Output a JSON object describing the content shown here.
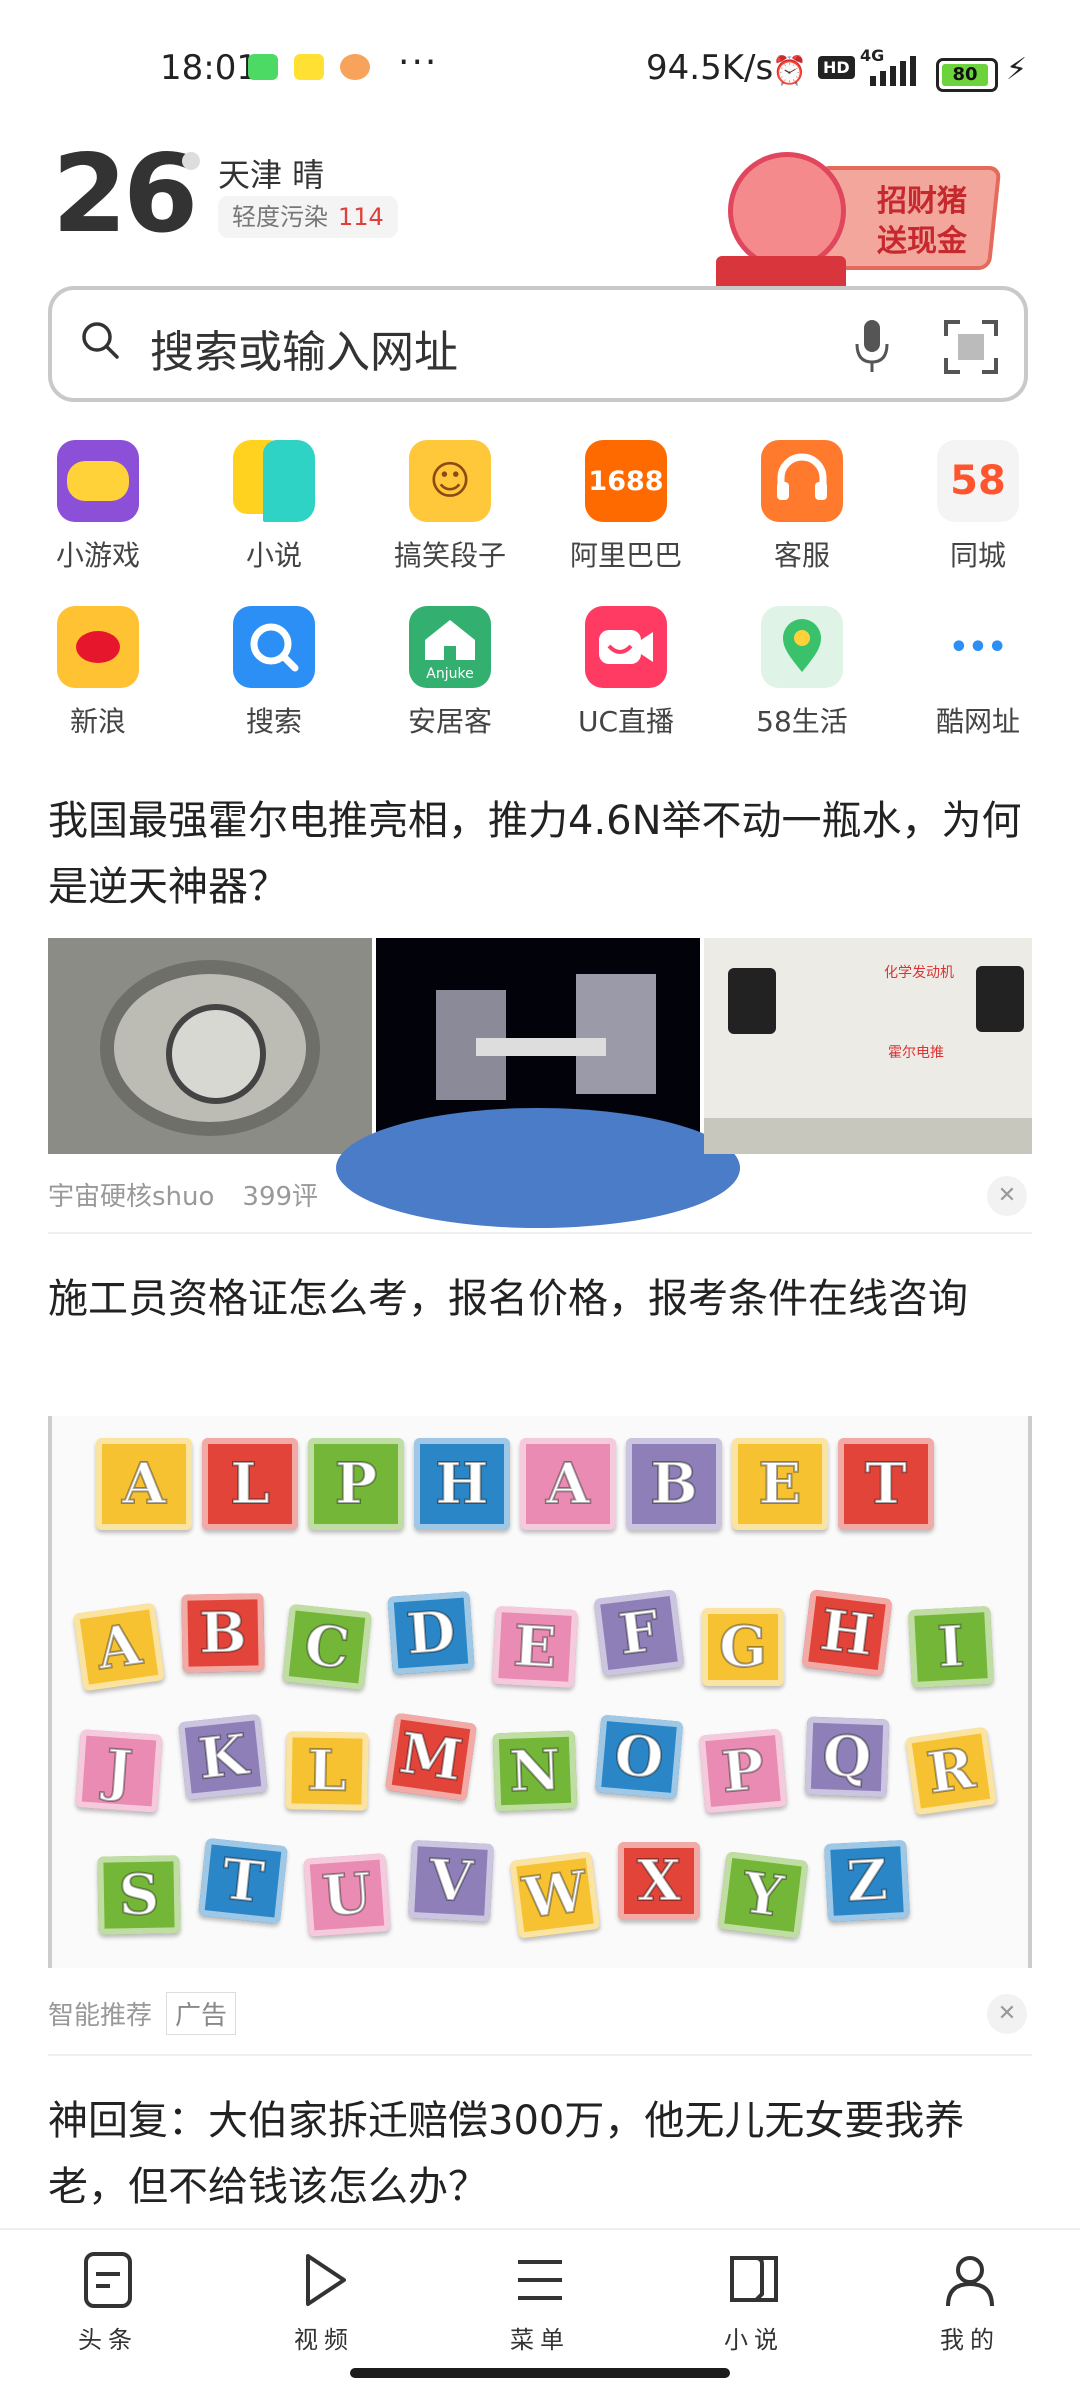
{
  "status_bar": {
    "time": "18:01",
    "more": "···",
    "speed": "94.5K/s",
    "hd": "HD",
    "network": "4G",
    "battery": "80"
  },
  "weather": {
    "temperature": "26",
    "city_condition": "天津  晴",
    "air_quality": "轻度污染",
    "aqi": "114"
  },
  "promo": {
    "line1": "招财猪",
    "line2": "送现金"
  },
  "search": {
    "placeholder": "搜索或输入网址"
  },
  "apps": [
    {
      "label": "小游戏",
      "icon": "game-controller-icon"
    },
    {
      "label": "小说",
      "icon": "novel-bubble-icon"
    },
    {
      "label": "搞笑段子",
      "icon": "funny-face-icon"
    },
    {
      "label": "阿里巴巴",
      "icon": "1688-icon",
      "text": "1688"
    },
    {
      "label": "客服",
      "icon": "headset-icon"
    },
    {
      "label": "同城",
      "icon": "58-icon",
      "text": "58"
    },
    {
      "label": "新浪",
      "icon": "sina-weibo-icon"
    },
    {
      "label": "搜索",
      "icon": "search-app-icon"
    },
    {
      "label": "安居客",
      "icon": "anjuke-house-icon",
      "text": "Anjuke"
    },
    {
      "label": "UC直播",
      "icon": "uc-live-icon"
    },
    {
      "label": "58生活",
      "icon": "map-pin-icon"
    },
    {
      "label": "酷网址",
      "icon": "more-dots-icon",
      "text": "•••"
    }
  ],
  "feed": [
    {
      "title": "我国最强霍尔电推亮相，推力4.6N举不动一瓶水，为何是逆天神器？",
      "source": "宇宙硬核shuo",
      "comments": "399评",
      "image_labels": [
        "化学发动机",
        "霍尔电推"
      ]
    },
    {
      "title": "施工员资格证怎么考，报名价格，报考条件在线咨询",
      "source": "智能推荐",
      "tag": "广告",
      "ad_heading": [
        "A",
        "L",
        "P",
        "H",
        "A",
        "B",
        "E",
        "T"
      ],
      "ad_letters": [
        "A",
        "B",
        "C",
        "D",
        "E",
        "F",
        "G",
        "H",
        "I",
        "J",
        "K",
        "L",
        "M",
        "N",
        "O",
        "P",
        "Q",
        "R",
        "S",
        "T",
        "U",
        "V",
        "W",
        "X",
        "Y",
        "Z"
      ]
    },
    {
      "title": "神回复：大伯家拆迁赔偿300万，他无儿无女要我养老，但不给钱该怎么办？"
    }
  ],
  "bottom_nav": [
    {
      "label": "头条",
      "icon": "news-doc-icon"
    },
    {
      "label": "视频",
      "icon": "play-icon"
    },
    {
      "label": "菜单",
      "icon": "menu-icon"
    },
    {
      "label": "小说",
      "icon": "book-icon"
    },
    {
      "label": "我的",
      "icon": "profile-icon"
    }
  ],
  "colors": {
    "accent_red": "#e0403a",
    "game_purple": "#8b4fd8",
    "novel_yellow": "#ffd21f",
    "novel_teal": "#2fd3c5",
    "orange_1688": "#ff6a00",
    "headset_orange": "#ff7a2d",
    "weibo_yellow": "#ffc233",
    "search_blue": "#2b8ff5",
    "anjuke_green": "#33b06f",
    "uc_pink": "#ff3a63",
    "map_green": "#39c16c"
  }
}
